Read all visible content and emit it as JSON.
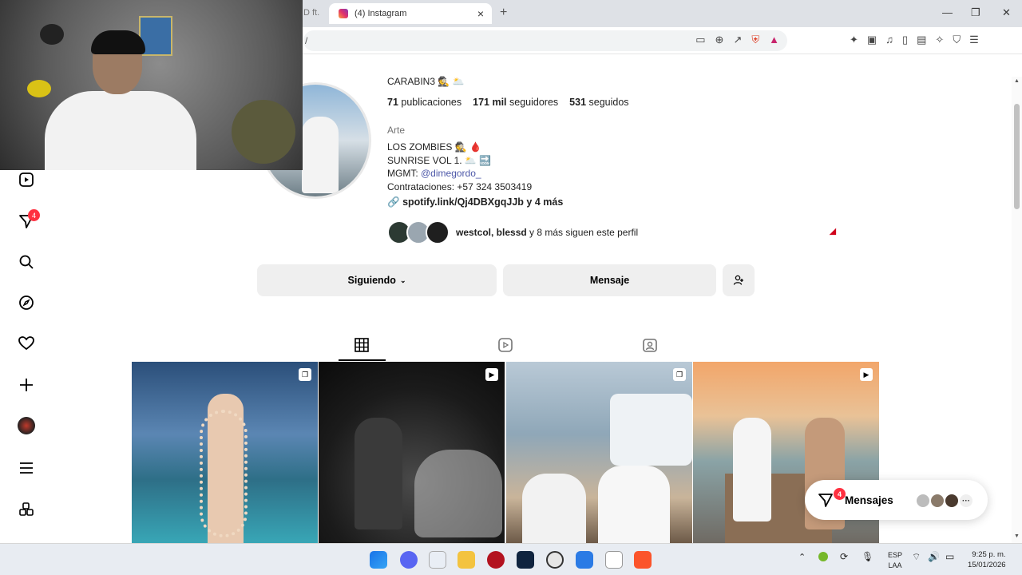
{
  "browser": {
    "prev_tab_title": "D ft.",
    "tab_title": "(4) Instagram",
    "new_tab": "+",
    "address": "/",
    "window_controls": [
      "—",
      "❐",
      "✕"
    ]
  },
  "nav": {
    "notification_count": "4"
  },
  "profile": {
    "name_line": "CARABIN3 🕵️ 🌥️",
    "posts_count": "71",
    "posts_label": "publicaciones",
    "followers_count": "171 mil",
    "followers_label": "seguidores",
    "following_count": "531",
    "following_label": "seguidos",
    "category": "Arte",
    "bio_line1": "LOS ZOMBIES 🕵️ 🩸",
    "bio_line2": "SUNRISE VOL 1. 🌥️ 🔜",
    "bio_mgmt_label": "MGMT: ",
    "bio_mgmt_handle": "@dimegordo_",
    "bio_contact": "Contrataciones: +57 324 3503419",
    "link_text": "spotify.link/Qj4DBXgqJJb y 4 más",
    "followed_by_names": "westcol, blessd",
    "followed_by_rest": " y 8 más siguen este perfil"
  },
  "buttons": {
    "following": "Siguiendo",
    "message": "Mensaje"
  },
  "messages": {
    "label": "Mensajes",
    "badge": "4"
  },
  "taskbar": {
    "lang_top": "ESP",
    "lang_bottom": "LAA",
    "time": "9:25 p. m.",
    "date": "15/01/2026"
  }
}
